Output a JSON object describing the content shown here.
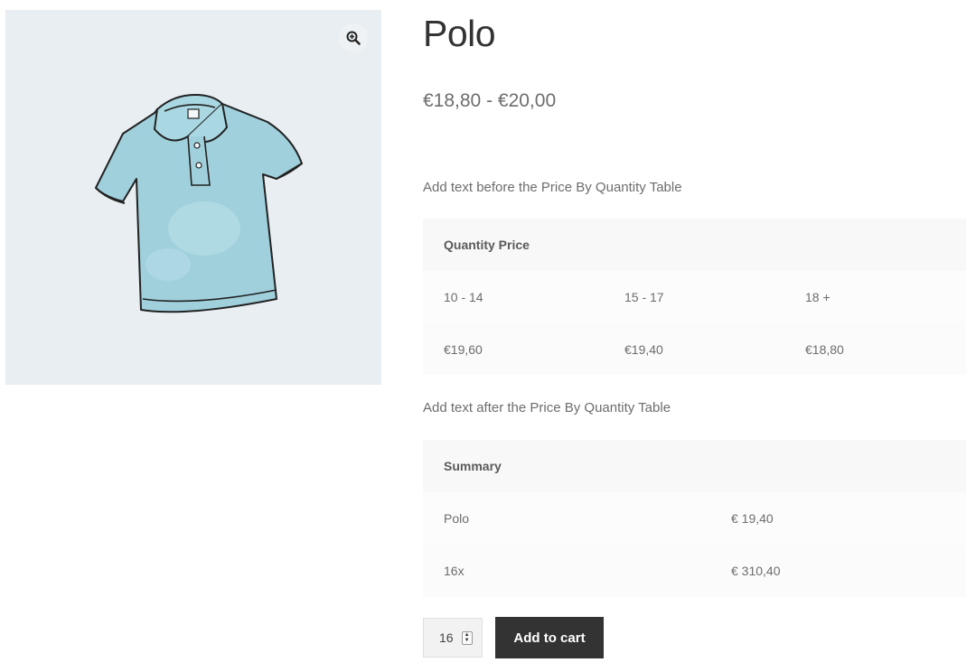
{
  "product": {
    "title": "Polo",
    "price_range": "€18,80 - €20,00",
    "image_alt": "polo-shirt-image"
  },
  "notes": {
    "before_table": "Add text before the Price By Quantity Table",
    "after_table": "Add text after the Price By Quantity Table"
  },
  "quantity_table": {
    "header": "Quantity Price",
    "ranges": [
      "10 - 14",
      "15 - 17",
      "18 +"
    ],
    "prices": [
      "€19,60",
      "€19,40",
      "€18,80"
    ]
  },
  "summary_table": {
    "header": "Summary",
    "rows": [
      {
        "label": "Polo",
        "value": "€ 19,40"
      },
      {
        "label": "16x",
        "value": "€ 310,40"
      }
    ]
  },
  "cart": {
    "quantity": "16",
    "add_label": "Add to cart"
  },
  "colors": {
    "gallery_bg": "#e8eef2",
    "button_bg": "#333333",
    "shirt": "#9fd0dc"
  },
  "icons": {
    "zoom": "zoom-in-icon",
    "spinner": "spinner-arrows-icon"
  }
}
